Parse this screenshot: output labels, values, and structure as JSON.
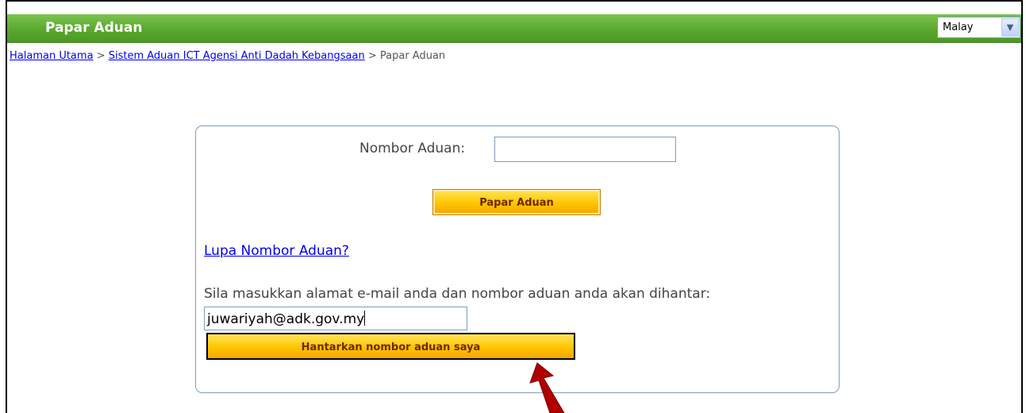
{
  "header": {
    "title": "Papar Aduan",
    "language_select": {
      "selected": "Malay",
      "arrow_icon": "chevron-down-icon"
    }
  },
  "breadcrumb": {
    "items": [
      "Halaman Utama",
      "Sistem Aduan ICT Agensi Anti Dadah Kebangsaan",
      "Papar Aduan"
    ],
    "separator": ">"
  },
  "form": {
    "nombor_label": "Nombor Aduan:",
    "nombor_value": "",
    "papar_button": "Papar Aduan",
    "lupa_link": "Lupa Nombor Aduan?",
    "instruction": "Sila masukkan alamat e-mail anda dan nombor aduan anda akan dihantar:",
    "email_value": "juwariyah@adk.gov.my",
    "hantar_button": "Hantarkan nombor aduan saya"
  },
  "annotation": {
    "arrow_icon": "red-arrow-icon",
    "arrow_color": "#b00000"
  },
  "colors": {
    "header_green": "#5aa82e",
    "button_yellow": "#ffc400",
    "panel_border": "#7b9ebd",
    "link_blue": "#0000ee"
  }
}
